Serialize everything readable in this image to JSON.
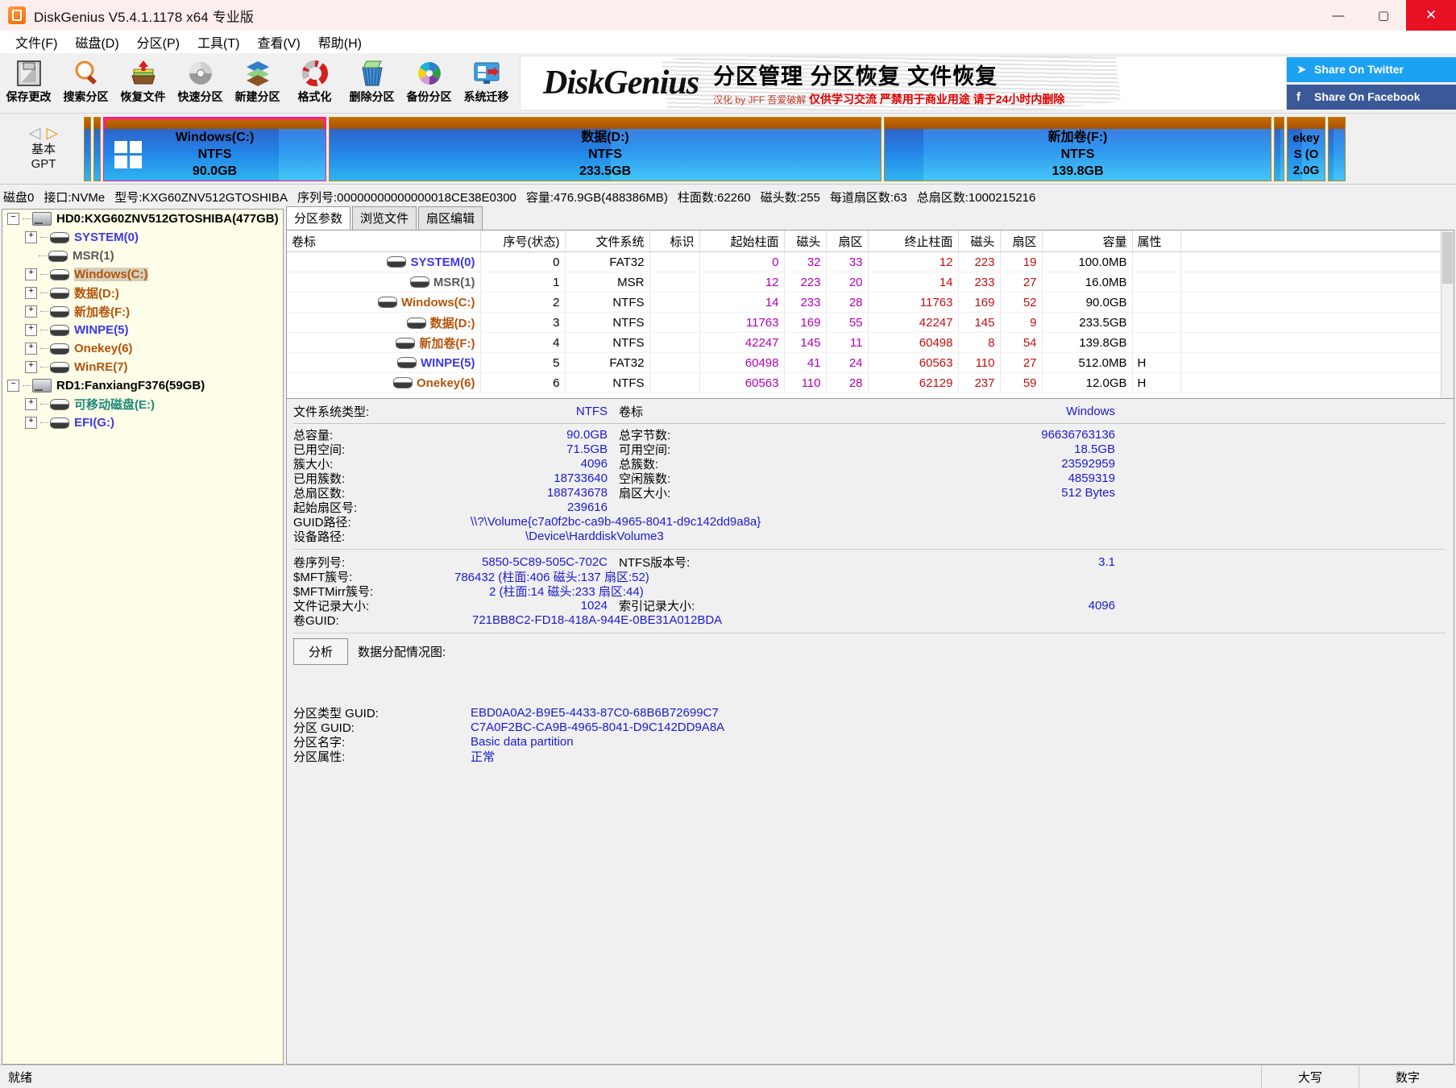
{
  "window": {
    "title": "DiskGenius V5.4.1.1178 x64 专业版",
    "minimize": "—",
    "maximize": "▢",
    "close": "✕"
  },
  "menu": [
    {
      "label": "文件(F)"
    },
    {
      "label": "磁盘(D)"
    },
    {
      "label": "分区(P)"
    },
    {
      "label": "工具(T)"
    },
    {
      "label": "查看(V)"
    },
    {
      "label": "帮助(H)"
    }
  ],
  "toolbar": {
    "buttons": [
      {
        "label": "保存更改",
        "icon": "save-icon"
      },
      {
        "label": "搜索分区",
        "icon": "magnifier-icon"
      },
      {
        "label": "恢复文件",
        "icon": "recover-files-icon"
      },
      {
        "label": "快速分区",
        "icon": "disc-icon"
      },
      {
        "label": "新建分区",
        "icon": "layers-icon"
      },
      {
        "label": "格式化",
        "icon": "donut-icon"
      },
      {
        "label": "删除分区",
        "icon": "trash-icon"
      },
      {
        "label": "备份分区",
        "icon": "pie-icon"
      },
      {
        "label": "系统迁移",
        "icon": "migrate-icon"
      }
    ]
  },
  "banner": {
    "logo_a": "D",
    "logo_b": "iskGenius",
    "headline": "分区管理 分区恢复 文件恢复",
    "sub_small": "汉化 by JFF 吾爱破解",
    "sub_big": "仅供学习交流 严禁用于商业用途 请于24小时内删除",
    "twitter": "Share On Twitter",
    "facebook": "Share On Facebook",
    "twitter_icon": "twitter-bird-icon",
    "facebook_icon": "facebook-f-icon"
  },
  "disk_panel": {
    "nav_prev": "◁",
    "nav_next": "▷",
    "type_line1": "基本",
    "type_line2": "GPT",
    "partitions": [
      {
        "name": "",
        "fs": "",
        "size": "",
        "width_pct": 0.9,
        "used_pct": 100,
        "selected": false,
        "tiny": true,
        "winlogo": false
      },
      {
        "name": "",
        "fs": "",
        "size": "",
        "width_pct": 0.9,
        "used_pct": 100,
        "selected": false,
        "tiny": true,
        "winlogo": false
      },
      {
        "name": "Windows(C:)",
        "fs": "NTFS",
        "size": "90.0GB",
        "width_pct": 17.5,
        "used_pct": 79,
        "selected": true,
        "tiny": false,
        "winlogo": true
      },
      {
        "name": "数据(D:)",
        "fs": "NTFS",
        "size": "233.5GB",
        "width_pct": 42.5,
        "used_pct": 51,
        "selected": false,
        "tiny": false,
        "winlogo": false
      },
      {
        "name": "新加卷(F:)",
        "fs": "NTFS",
        "size": "139.8GB",
        "width_pct": 29.5,
        "used_pct": 10,
        "selected": false,
        "tiny": false,
        "winlogo": false
      },
      {
        "name": "",
        "fs": "",
        "size": "",
        "width_pct": 1.0,
        "used_pct": 60,
        "selected": false,
        "tiny": true,
        "winlogo": false
      },
      {
        "name": "ekey",
        "fs": "S (O",
        "size": "2.0G",
        "width_pct": 3.6,
        "used_pct": 40,
        "selected": false,
        "tiny": true,
        "winlogo": false
      },
      {
        "name": "",
        "fs": "",
        "size": "",
        "width_pct": 1.6,
        "used_pct": 30,
        "selected": false,
        "tiny": true,
        "winlogo": false
      }
    ],
    "spec": [
      "磁盘0",
      "接口:NVMe",
      "型号:KXG60ZNV512GTOSHIBA",
      "序列号:00000000000000018CE38E0300",
      "容量:476.9GB(488386MB)",
      "柱面数:62260",
      "磁头数:255",
      "每道扇区数:63",
      "总扇区数:1000215216"
    ]
  },
  "tree": [
    {
      "label": "HD0:KXG60ZNV512GTOSHIBA(477GB)",
      "level": 0,
      "expander": "−",
      "icon": "harddisk-icon",
      "color": "c-black",
      "selected": false
    },
    {
      "label": "SYSTEM(0)",
      "level": 1,
      "expander": "+",
      "icon": "partition-icon",
      "color": "c-blue",
      "selected": false
    },
    {
      "label": "MSR(1)",
      "level": 1,
      "expander": "",
      "icon": "partition-icon",
      "color": "c-gray",
      "selected": false
    },
    {
      "label": "Windows(C:)",
      "level": 1,
      "expander": "+",
      "icon": "partition-icon",
      "color": "c-orange",
      "selected": true
    },
    {
      "label": "数据(D:)",
      "level": 1,
      "expander": "+",
      "icon": "partition-icon",
      "color": "c-orange",
      "selected": false
    },
    {
      "label": "新加卷(F:)",
      "level": 1,
      "expander": "+",
      "icon": "partition-icon",
      "color": "c-orange",
      "selected": false
    },
    {
      "label": "WINPE(5)",
      "level": 1,
      "expander": "+",
      "icon": "partition-icon",
      "color": "c-blue",
      "selected": false
    },
    {
      "label": "Onekey(6)",
      "level": 1,
      "expander": "+",
      "icon": "partition-icon",
      "color": "c-orange",
      "selected": false
    },
    {
      "label": "WinRE(7)",
      "level": 1,
      "expander": "+",
      "icon": "partition-icon",
      "color": "c-orange",
      "selected": false
    },
    {
      "label": "RD1:FanxiangF376(59GB)",
      "level": 0,
      "expander": "−",
      "icon": "harddisk-icon",
      "color": "c-black",
      "selected": false
    },
    {
      "label": "可移动磁盘(E:)",
      "level": 1,
      "expander": "+",
      "icon": "partition-icon",
      "color": "c-teal",
      "selected": false
    },
    {
      "label": "EFI(G:)",
      "level": 1,
      "expander": "+",
      "icon": "partition-icon",
      "color": "c-blue",
      "selected": false
    }
  ],
  "tabs": [
    {
      "label": "分区参数",
      "active": true
    },
    {
      "label": "浏览文件",
      "active": false
    },
    {
      "label": "扇区编辑",
      "active": false
    }
  ],
  "table": {
    "headers": [
      "卷标",
      "序号(状态)",
      "文件系统",
      "标识",
      "起始柱面",
      "磁头",
      "扇区",
      "终止柱面",
      "磁头",
      "扇区",
      "容量",
      "属性"
    ],
    "rows": [
      {
        "vol": "SYSTEM(0)",
        "color": "c-blue",
        "idx": "0",
        "fs": "FAT32",
        "flag": "",
        "s_cyl": "0",
        "s_head": "32",
        "s_sec": "33",
        "e_cyl": "12",
        "e_head": "223",
        "e_sec": "19",
        "size": "100.0MB",
        "attr": ""
      },
      {
        "vol": "MSR(1)",
        "color": "c-gray",
        "idx": "1",
        "fs": "MSR",
        "flag": "",
        "s_cyl": "12",
        "s_head": "223",
        "s_sec": "20",
        "e_cyl": "14",
        "e_head": "233",
        "e_sec": "27",
        "size": "16.0MB",
        "attr": ""
      },
      {
        "vol": "Windows(C:)",
        "color": "c-orange",
        "idx": "2",
        "fs": "NTFS",
        "flag": "",
        "s_cyl": "14",
        "s_head": "233",
        "s_sec": "28",
        "e_cyl": "11763",
        "e_head": "169",
        "e_sec": "52",
        "size": "90.0GB",
        "attr": ""
      },
      {
        "vol": "数据(D:)",
        "color": "c-orange",
        "idx": "3",
        "fs": "NTFS",
        "flag": "",
        "s_cyl": "11763",
        "s_head": "169",
        "s_sec": "55",
        "e_cyl": "42247",
        "e_head": "145",
        "e_sec": "9",
        "size": "233.5GB",
        "attr": ""
      },
      {
        "vol": "新加卷(F:)",
        "color": "c-orange",
        "idx": "4",
        "fs": "NTFS",
        "flag": "",
        "s_cyl": "42247",
        "s_head": "145",
        "s_sec": "11",
        "e_cyl": "60498",
        "e_head": "8",
        "e_sec": "54",
        "size": "139.8GB",
        "attr": ""
      },
      {
        "vol": "WINPE(5)",
        "color": "c-blue",
        "idx": "5",
        "fs": "FAT32",
        "flag": "",
        "s_cyl": "60498",
        "s_head": "41",
        "s_sec": "24",
        "e_cyl": "60563",
        "e_head": "110",
        "e_sec": "27",
        "size": "512.0MB",
        "attr": "H"
      },
      {
        "vol": "Onekey(6)",
        "color": "c-orange",
        "idx": "6",
        "fs": "NTFS",
        "flag": "",
        "s_cyl": "60563",
        "s_head": "110",
        "s_sec": "28",
        "e_cyl": "62129",
        "e_head": "237",
        "e_sec": "59",
        "size": "12.0GB",
        "attr": "H"
      }
    ]
  },
  "fsinfo": {
    "fstype_label": "文件系统类型:",
    "fstype_value": "NTFS",
    "vollabel_label": "卷标",
    "vollabel_value": "Windows",
    "total_cap_label": "总容量:",
    "total_cap_value": "90.0GB",
    "total_bytes_label": "总字节数:",
    "total_bytes_value": "96636763136",
    "used_label": "已用空间:",
    "used_value": "71.5GB",
    "free_label": "可用空间:",
    "free_value": "18.5GB",
    "cluster_label": "簇大小:",
    "cluster_value": "4096",
    "total_clusters_label": "总簇数:",
    "total_clusters_value": "23592959",
    "used_clusters_label": "已用簇数:",
    "used_clusters_value": "18733640",
    "free_clusters_label": "空闲簇数:",
    "free_clusters_value": "4859319",
    "total_sectors_label": "总扇区数:",
    "total_sectors_value": "188743678",
    "sector_size_label": "扇区大小:",
    "sector_size_value": "512 Bytes",
    "start_sector_label": "起始扇区号:",
    "start_sector_value": "239616",
    "guid_path_label": "GUID路径:",
    "guid_path_value": "\\\\?\\Volume{c7a0f2bc-ca9b-4965-8041-d9c142dd9a8a}",
    "device_path_label": "设备路径:",
    "device_path_value": "\\Device\\HarddiskVolume3",
    "vol_serial_label": "卷序列号:",
    "vol_serial_value": "5850-5C89-505C-702C",
    "ntfs_ver_label": "NTFS版本号:",
    "ntfs_ver_value": "3.1",
    "mft_label": "$MFT簇号:",
    "mft_value": "786432 (柱面:406 磁头:137 扇区:52)",
    "mftmirr_label": "$MFTMirr簇号:",
    "mftmirr_value": "2 (柱面:14 磁头:233 扇区:44)",
    "filerec_label": "文件记录大小:",
    "filerec_value": "1024",
    "indexrec_label": "索引记录大小:",
    "indexrec_value": "4096",
    "volguid_label": "卷GUID:",
    "volguid_value": "721BB8C2-FD18-418A-944E-0BE31A012BDA",
    "analyze_button": "分析",
    "alloc_map_label": "数据分配情况图:",
    "part_type_guid_label": "分区类型 GUID:",
    "part_type_guid_value": "EBD0A0A2-B9E5-4433-87C0-68B6B72699C7",
    "part_guid_label": "分区 GUID:",
    "part_guid_value": "C7A0F2BC-CA9B-4965-8041-D9C142DD9A8A",
    "part_name_label": "分区名字:",
    "part_name_value": "Basic data partition",
    "part_attr_label": "分区属性:",
    "part_attr_value": "正常"
  },
  "status": {
    "ready": "就绪",
    "caps": "大写",
    "num": "数字"
  }
}
